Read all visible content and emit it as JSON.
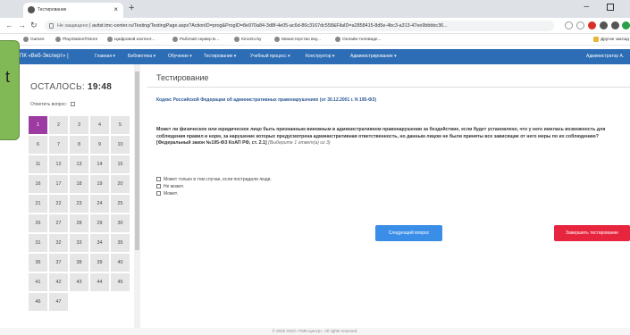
{
  "browser": {
    "tab_title": "Тестирование",
    "tab_close": "×",
    "new_tab": "+",
    "url_info": "Не защищено",
    "url_text": "avitst.tmc-center.ru/Testing/TestingPage.aspx?ActionID=prog&ProgID=8e970a84-3d8f-4e05-ac6d-86c3167dc558&FilaID=a2858415-8d5e-4bc3-a313-47ee9bbbbc36...",
    "bookmarks": [
      "Games",
      "PlayStation®Store",
      "Цифровой контент...",
      "Рабочий сервер Б...",
      "KinoGo.by",
      "Министерство вну...",
      "Онлайн-телевиде..."
    ],
    "other_bookmarks": "Другие заклад"
  },
  "sitenav": {
    "brand": "ПК «Веб-Эксперт» |",
    "items": [
      "Главная ▾",
      "Библиотека ▾",
      "Обучение ▾",
      "Тестирование ▾",
      "Учебный процесс ▾",
      "Конструктор ▾",
      "Администрирование ▾"
    ],
    "user": "Администратор А."
  },
  "sidebar": {
    "timer_label": "ОСТАЛОСЬ:",
    "timer_value": "19:48",
    "mark_label": "Отметить вопрос: ",
    "numbers": [
      "1",
      "2",
      "3",
      "4",
      "5",
      "6",
      "7",
      "8",
      "9",
      "10",
      "11",
      "12",
      "13",
      "14",
      "15",
      "16",
      "17",
      "18",
      "19",
      "20",
      "21",
      "22",
      "23",
      "24",
      "25",
      "26",
      "27",
      "28",
      "29",
      "30",
      "31",
      "32",
      "33",
      "34",
      "35",
      "36",
      "37",
      "38",
      "39",
      "40",
      "41",
      "42",
      "43",
      "44",
      "45",
      "46",
      "47"
    ],
    "active": "1"
  },
  "overlay": {
    "text": "t"
  },
  "main": {
    "title": "Тестирование",
    "law": "Кодекс Российской Федерации об административных правонарушениях (от 30.12.2001 г. N 195-ФЗ)",
    "question": "Может ли физическое или юридическое лицо быть признанным виновным в административном правонарушении за бездействие, если будет установлено, что у него имелась возможность для соблюдения правил и норм, за нарушение которых предусмотрена административная ответственность, но данным лицом не были приняты все зависящие от него меры по их соблюдению? [Федеральный закон №195-ФЗ КоАП РФ, ст. 2.1]",
    "hint": " (Выберите 1 ответ(а) из 3)",
    "answers": [
      "Может только в том случае, если пострадали люди.",
      "Не может.",
      "Может."
    ],
    "next_button": "Следующий вопрос",
    "finish_button": "Завершить тестирование"
  },
  "footer": "© 2020 ООО «ТМК-Центр». All rights reserved."
}
